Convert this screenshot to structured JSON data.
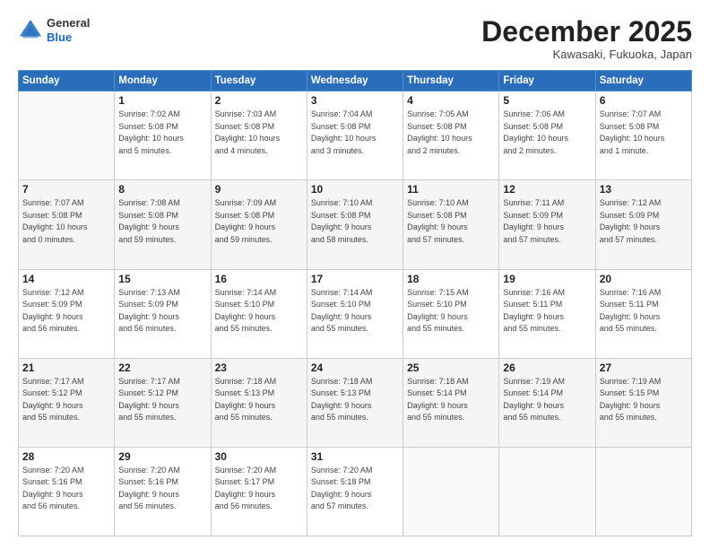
{
  "logo": {
    "general": "General",
    "blue": "Blue"
  },
  "header": {
    "month": "December 2025",
    "location": "Kawasaki, Fukuoka, Japan"
  },
  "weekdays": [
    "Sunday",
    "Monday",
    "Tuesday",
    "Wednesday",
    "Thursday",
    "Friday",
    "Saturday"
  ],
  "weeks": [
    [
      {
        "day": "",
        "info": ""
      },
      {
        "day": "1",
        "info": "Sunrise: 7:02 AM\nSunset: 5:08 PM\nDaylight: 10 hours\nand 5 minutes."
      },
      {
        "day": "2",
        "info": "Sunrise: 7:03 AM\nSunset: 5:08 PM\nDaylight: 10 hours\nand 4 minutes."
      },
      {
        "day": "3",
        "info": "Sunrise: 7:04 AM\nSunset: 5:08 PM\nDaylight: 10 hours\nand 3 minutes."
      },
      {
        "day": "4",
        "info": "Sunrise: 7:05 AM\nSunset: 5:08 PM\nDaylight: 10 hours\nand 2 minutes."
      },
      {
        "day": "5",
        "info": "Sunrise: 7:06 AM\nSunset: 5:08 PM\nDaylight: 10 hours\nand 2 minutes."
      },
      {
        "day": "6",
        "info": "Sunrise: 7:07 AM\nSunset: 5:08 PM\nDaylight: 10 hours\nand 1 minute."
      }
    ],
    [
      {
        "day": "7",
        "info": "Sunrise: 7:07 AM\nSunset: 5:08 PM\nDaylight: 10 hours\nand 0 minutes."
      },
      {
        "day": "8",
        "info": "Sunrise: 7:08 AM\nSunset: 5:08 PM\nDaylight: 9 hours\nand 59 minutes."
      },
      {
        "day": "9",
        "info": "Sunrise: 7:09 AM\nSunset: 5:08 PM\nDaylight: 9 hours\nand 59 minutes."
      },
      {
        "day": "10",
        "info": "Sunrise: 7:10 AM\nSunset: 5:08 PM\nDaylight: 9 hours\nand 58 minutes."
      },
      {
        "day": "11",
        "info": "Sunrise: 7:10 AM\nSunset: 5:08 PM\nDaylight: 9 hours\nand 57 minutes."
      },
      {
        "day": "12",
        "info": "Sunrise: 7:11 AM\nSunset: 5:09 PM\nDaylight: 9 hours\nand 57 minutes."
      },
      {
        "day": "13",
        "info": "Sunrise: 7:12 AM\nSunset: 5:09 PM\nDaylight: 9 hours\nand 57 minutes."
      }
    ],
    [
      {
        "day": "14",
        "info": "Sunrise: 7:12 AM\nSunset: 5:09 PM\nDaylight: 9 hours\nand 56 minutes."
      },
      {
        "day": "15",
        "info": "Sunrise: 7:13 AM\nSunset: 5:09 PM\nDaylight: 9 hours\nand 56 minutes."
      },
      {
        "day": "16",
        "info": "Sunrise: 7:14 AM\nSunset: 5:10 PM\nDaylight: 9 hours\nand 55 minutes."
      },
      {
        "day": "17",
        "info": "Sunrise: 7:14 AM\nSunset: 5:10 PM\nDaylight: 9 hours\nand 55 minutes."
      },
      {
        "day": "18",
        "info": "Sunrise: 7:15 AM\nSunset: 5:10 PM\nDaylight: 9 hours\nand 55 minutes."
      },
      {
        "day": "19",
        "info": "Sunrise: 7:16 AM\nSunset: 5:11 PM\nDaylight: 9 hours\nand 55 minutes."
      },
      {
        "day": "20",
        "info": "Sunrise: 7:16 AM\nSunset: 5:11 PM\nDaylight: 9 hours\nand 55 minutes."
      }
    ],
    [
      {
        "day": "21",
        "info": "Sunrise: 7:17 AM\nSunset: 5:12 PM\nDaylight: 9 hours\nand 55 minutes."
      },
      {
        "day": "22",
        "info": "Sunrise: 7:17 AM\nSunset: 5:12 PM\nDaylight: 9 hours\nand 55 minutes."
      },
      {
        "day": "23",
        "info": "Sunrise: 7:18 AM\nSunset: 5:13 PM\nDaylight: 9 hours\nand 55 minutes."
      },
      {
        "day": "24",
        "info": "Sunrise: 7:18 AM\nSunset: 5:13 PM\nDaylight: 9 hours\nand 55 minutes."
      },
      {
        "day": "25",
        "info": "Sunrise: 7:18 AM\nSunset: 5:14 PM\nDaylight: 9 hours\nand 55 minutes."
      },
      {
        "day": "26",
        "info": "Sunrise: 7:19 AM\nSunset: 5:14 PM\nDaylight: 9 hours\nand 55 minutes."
      },
      {
        "day": "27",
        "info": "Sunrise: 7:19 AM\nSunset: 5:15 PM\nDaylight: 9 hours\nand 55 minutes."
      }
    ],
    [
      {
        "day": "28",
        "info": "Sunrise: 7:20 AM\nSunset: 5:16 PM\nDaylight: 9 hours\nand 56 minutes."
      },
      {
        "day": "29",
        "info": "Sunrise: 7:20 AM\nSunset: 5:16 PM\nDaylight: 9 hours\nand 56 minutes."
      },
      {
        "day": "30",
        "info": "Sunrise: 7:20 AM\nSunset: 5:17 PM\nDaylight: 9 hours\nand 56 minutes."
      },
      {
        "day": "31",
        "info": "Sunrise: 7:20 AM\nSunset: 5:18 PM\nDaylight: 9 hours\nand 57 minutes."
      },
      {
        "day": "",
        "info": ""
      },
      {
        "day": "",
        "info": ""
      },
      {
        "day": "",
        "info": ""
      }
    ]
  ]
}
